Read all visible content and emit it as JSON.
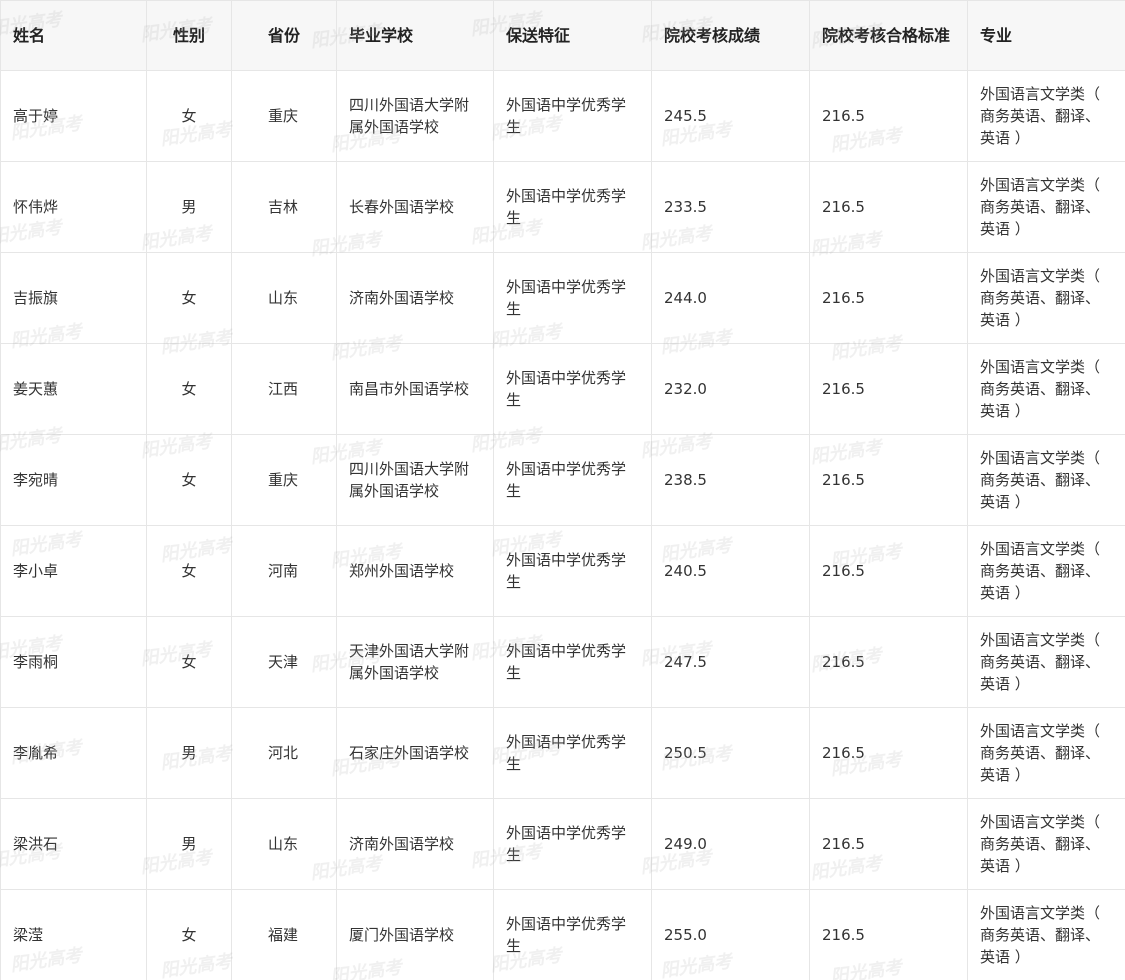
{
  "table": {
    "headers": [
      "姓名",
      "性别",
      "省份",
      "毕业学校",
      "保送特征",
      "院校考核成绩",
      "院校考核合格标准",
      "专业"
    ],
    "rows": [
      {
        "name": "高于婷",
        "gender": "女",
        "province": "重庆",
        "school": "四川外国语大学附属外国语学校",
        "feature": "外国语中学优秀学生",
        "score": "245.5",
        "standard": "216.5",
        "major": "外国语言文学类（ 商务英语、翻译、英语 ）"
      },
      {
        "name": "怀伟烨",
        "gender": "男",
        "province": "吉林",
        "school": "长春外国语学校",
        "feature": "外国语中学优秀学生",
        "score": "233.5",
        "standard": "216.5",
        "major": "外国语言文学类（ 商务英语、翻译、英语 ）"
      },
      {
        "name": "吉振旗",
        "gender": "女",
        "province": "山东",
        "school": "济南外国语学校",
        "feature": "外国语中学优秀学生",
        "score": "244.0",
        "standard": "216.5",
        "major": "外国语言文学类（ 商务英语、翻译、英语 ）"
      },
      {
        "name": "姜天蕙",
        "gender": "女",
        "province": "江西",
        "school": "南昌市外国语学校",
        "feature": "外国语中学优秀学生",
        "score": "232.0",
        "standard": "216.5",
        "major": "外国语言文学类（ 商务英语、翻译、英语 ）"
      },
      {
        "name": "李宛晴",
        "gender": "女",
        "province": "重庆",
        "school": "四川外国语大学附属外国语学校",
        "feature": "外国语中学优秀学生",
        "score": "238.5",
        "standard": "216.5",
        "major": "外国语言文学类（ 商务英语、翻译、英语 ）"
      },
      {
        "name": "李小卓",
        "gender": "女",
        "province": "河南",
        "school": "郑州外国语学校",
        "feature": "外国语中学优秀学生",
        "score": "240.5",
        "standard": "216.5",
        "major": "外国语言文学类（ 商务英语、翻译、英语 ）"
      },
      {
        "name": "李雨桐",
        "gender": "女",
        "province": "天津",
        "school": "天津外国语大学附属外国语学校",
        "feature": "外国语中学优秀学生",
        "score": "247.5",
        "standard": "216.5",
        "major": "外国语言文学类（ 商务英语、翻译、英语 ）"
      },
      {
        "name": "李胤希",
        "gender": "男",
        "province": "河北",
        "school": "石家庄外国语学校",
        "feature": "外国语中学优秀学生",
        "score": "250.5",
        "standard": "216.5",
        "major": "外国语言文学类（ 商务英语、翻译、英语 ）"
      },
      {
        "name": "梁洪石",
        "gender": "男",
        "province": "山东",
        "school": "济南外国语学校",
        "feature": "外国语中学优秀学生",
        "score": "249.0",
        "standard": "216.5",
        "major": "外国语言文学类（ 商务英语、翻译、英语 ）"
      },
      {
        "name": "梁滢",
        "gender": "女",
        "province": "福建",
        "school": "厦门外国语学校",
        "feature": "外国语中学优秀学生",
        "score": "255.0",
        "standard": "216.5",
        "major": "外国语言文学类（ 商务英语、翻译、英语 ）"
      }
    ]
  },
  "watermark": {
    "text": "阳光高考"
  }
}
